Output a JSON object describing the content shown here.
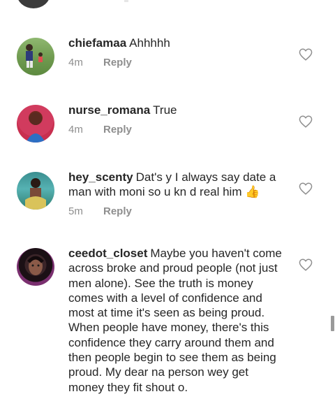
{
  "comments": [
    {
      "username": "chiefamaa",
      "text": "Ahhhhh",
      "time": "4m",
      "reply": "Reply"
    },
    {
      "username": "nurse_romana",
      "text": "True",
      "time": "4m",
      "reply": "Reply"
    },
    {
      "username": "hey_scenty",
      "text": "Dat's y I always say date a man with moni so u kn d real him 👍",
      "time": "5m",
      "reply": "Reply"
    },
    {
      "username": "ceedot_closet",
      "text": "Maybe you haven't come across broke and proud people (not just men alone). See the truth is money comes with a level of confidence and most at time it's seen as being proud. When people have money, there's this confidence they carry around them and then people begin to see them as being proud. My dear na person wey get money they fit shout o."
    }
  ]
}
